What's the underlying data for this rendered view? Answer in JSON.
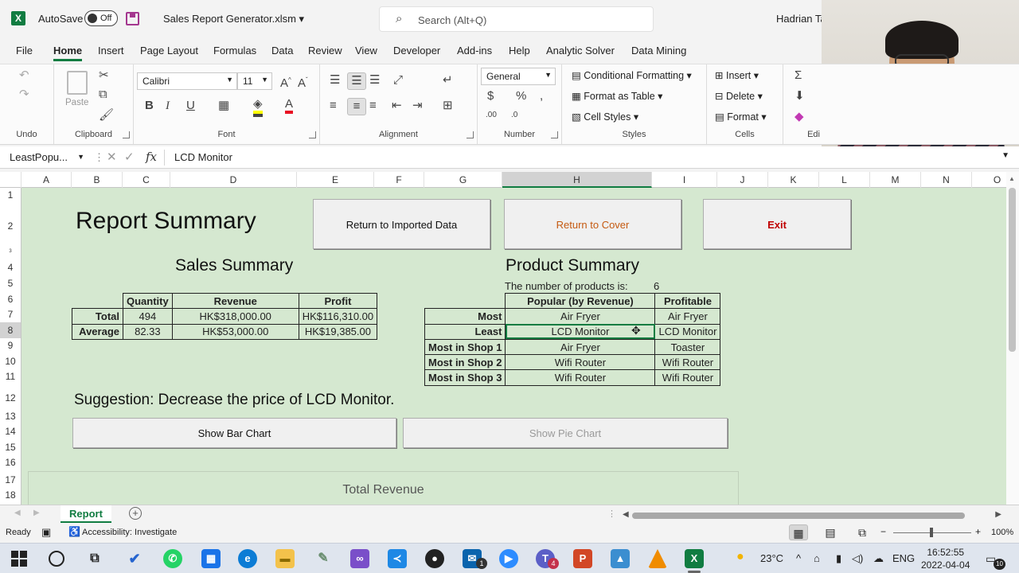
{
  "titlebar": {
    "autosave_label": "AutoSave",
    "autosave_state": "Off",
    "filename": "Sales Report Generator.xlsm",
    "search_placeholder": "Search (Alt+Q)",
    "user": "Hadrian Tai"
  },
  "ribbon_tabs": [
    "File",
    "Home",
    "Insert",
    "Page Layout",
    "Formulas",
    "Data",
    "Review",
    "View",
    "Developer",
    "Add-ins",
    "Help",
    "Analytic Solver",
    "Data Mining"
  ],
  "active_tab": "Home",
  "ribbon": {
    "undo_label": "Undo",
    "clipboard_label": "Clipboard",
    "paste_label": "Paste",
    "font_label": "Font",
    "font_name": "Calibri",
    "font_size": "11",
    "alignment_label": "Alignment",
    "number_label": "Number",
    "number_format": "General",
    "styles_label": "Styles",
    "conditional_formatting": "Conditional Formatting",
    "format_as_table": "Format as Table",
    "cell_styles": "Cell Styles",
    "cells_label": "Cells",
    "insert": "Insert",
    "delete": "Delete",
    "format": "Format",
    "editing_label": "Edi",
    "font_color": "#e81123",
    "highlight_color": "#ffff00"
  },
  "formula_bar": {
    "name_box": "LeastPopu...",
    "content": "LCD Monitor"
  },
  "columns": [
    "A",
    "B",
    "C",
    "D",
    "E",
    "F",
    "G",
    "H",
    "I",
    "J",
    "K",
    "L",
    "M",
    "N",
    "O"
  ],
  "selected_column": "H",
  "rows": [
    "1",
    "2",
    "3",
    "4",
    "5",
    "6",
    "7",
    "8",
    "9",
    "10",
    "11",
    "12",
    "13",
    "14",
    "15",
    "16",
    "17",
    "18"
  ],
  "selected_row": "8",
  "sheet": {
    "title": "Report Summary",
    "buttons": {
      "return_imported": "Return to Imported Data",
      "return_cover": "Return to Cover",
      "exit": "Exit",
      "bar_chart": "Show Bar Chart",
      "pie_chart": "Show Pie Chart"
    },
    "button_colors": {
      "return_cover": "#c55a11",
      "exit": "#c00000"
    },
    "sales_summary": {
      "heading": "Sales Summary",
      "headers": [
        "Quantity",
        "Revenue",
        "Profit"
      ],
      "rows": [
        {
          "label": "Total",
          "quantity": "494",
          "revenue": "HK$318,000.00",
          "profit": "HK$116,310.00"
        },
        {
          "label": "Average",
          "quantity": "82.33",
          "revenue": "HK$53,000.00",
          "profit": "HK$19,385.00"
        }
      ]
    },
    "product_summary": {
      "heading": "Product Summary",
      "count_label": "The number of products is:",
      "count_value": "6",
      "headers": [
        "Popular (by Revenue)",
        "Profitable"
      ],
      "rows": [
        {
          "label": "Most",
          "popular": "Air Fryer",
          "profitable": "Air Fryer"
        },
        {
          "label": "Least",
          "popular": "LCD Monitor",
          "profitable": "LCD Monitor"
        },
        {
          "label": "Most in Shop 1",
          "popular": "Air Fryer",
          "profitable": "Toaster"
        },
        {
          "label": "Most in Shop 2",
          "popular": "Wifi Router",
          "profitable": "Wifi Router"
        },
        {
          "label": "Most in Shop 3",
          "popular": "Wifi Router",
          "profitable": "Wifi Router"
        }
      ]
    },
    "suggestion": "Suggestion: Decrease the price of LCD Monitor.",
    "chart_title": "Total Revenue",
    "background_color": "#d5e8d0"
  },
  "sheet_tabs": [
    "Report"
  ],
  "status": {
    "ready": "Ready",
    "accessibility": "Accessibility: Investigate",
    "zoom": "100%"
  },
  "taskbar": {
    "temperature": "23°C",
    "language": "ENG",
    "time": "16:52:55",
    "date": "2022-04-04",
    "notification_count": "10",
    "outlook_badge": "1",
    "teams_badge": "4"
  }
}
